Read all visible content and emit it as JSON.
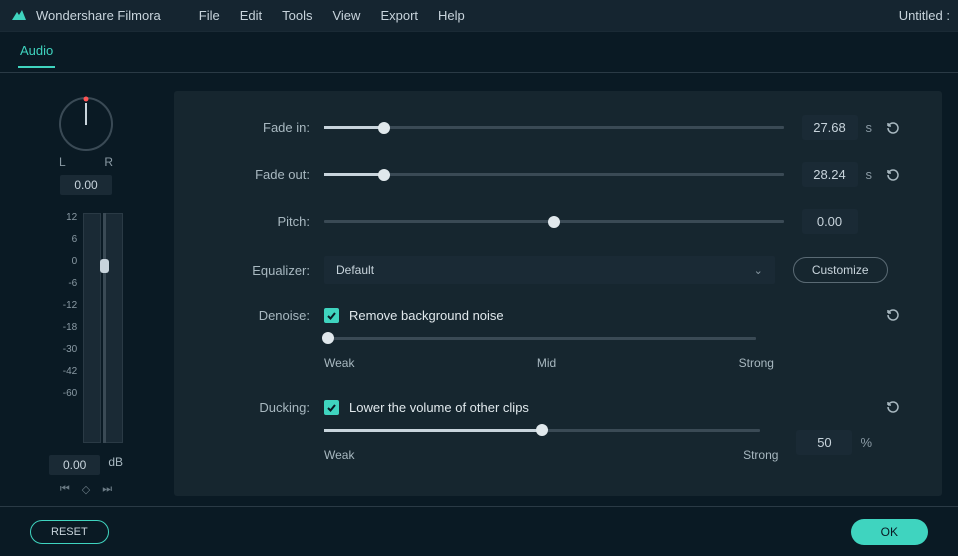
{
  "app": {
    "name": "Wondershare Filmora",
    "doc_title": "Untitled :"
  },
  "menu": [
    "File",
    "Edit",
    "Tools",
    "View",
    "Export",
    "Help"
  ],
  "tab": "Audio",
  "pan": {
    "left": "L",
    "right": "R",
    "value": "0.00"
  },
  "scale": [
    "12",
    "6",
    "0",
    "-6",
    "-12",
    "-18",
    "-30",
    "-42",
    "-60",
    ""
  ],
  "level": {
    "value": "0.00",
    "unit": "dB"
  },
  "controls": {
    "fadein": {
      "label": "Fade in:",
      "value": "27.68",
      "unit": "s",
      "pos": 13
    },
    "fadeout": {
      "label": "Fade out:",
      "value": "28.24",
      "unit": "s",
      "pos": 13
    },
    "pitch": {
      "label": "Pitch:",
      "value": "0.00",
      "pos": 50
    },
    "eq": {
      "label": "Equalizer:",
      "value": "Default",
      "button": "Customize"
    },
    "denoise": {
      "label": "Denoise:",
      "check_label": "Remove background noise",
      "weak": "Weak",
      "mid": "Mid",
      "strong": "Strong",
      "pos": 0
    },
    "ducking": {
      "label": "Ducking:",
      "check_label": "Lower the volume of other clips",
      "weak": "Weak",
      "strong": "Strong",
      "value": "50",
      "unit": "%",
      "pos": 50
    }
  },
  "footer": {
    "reset": "RESET",
    "ok": "OK"
  }
}
